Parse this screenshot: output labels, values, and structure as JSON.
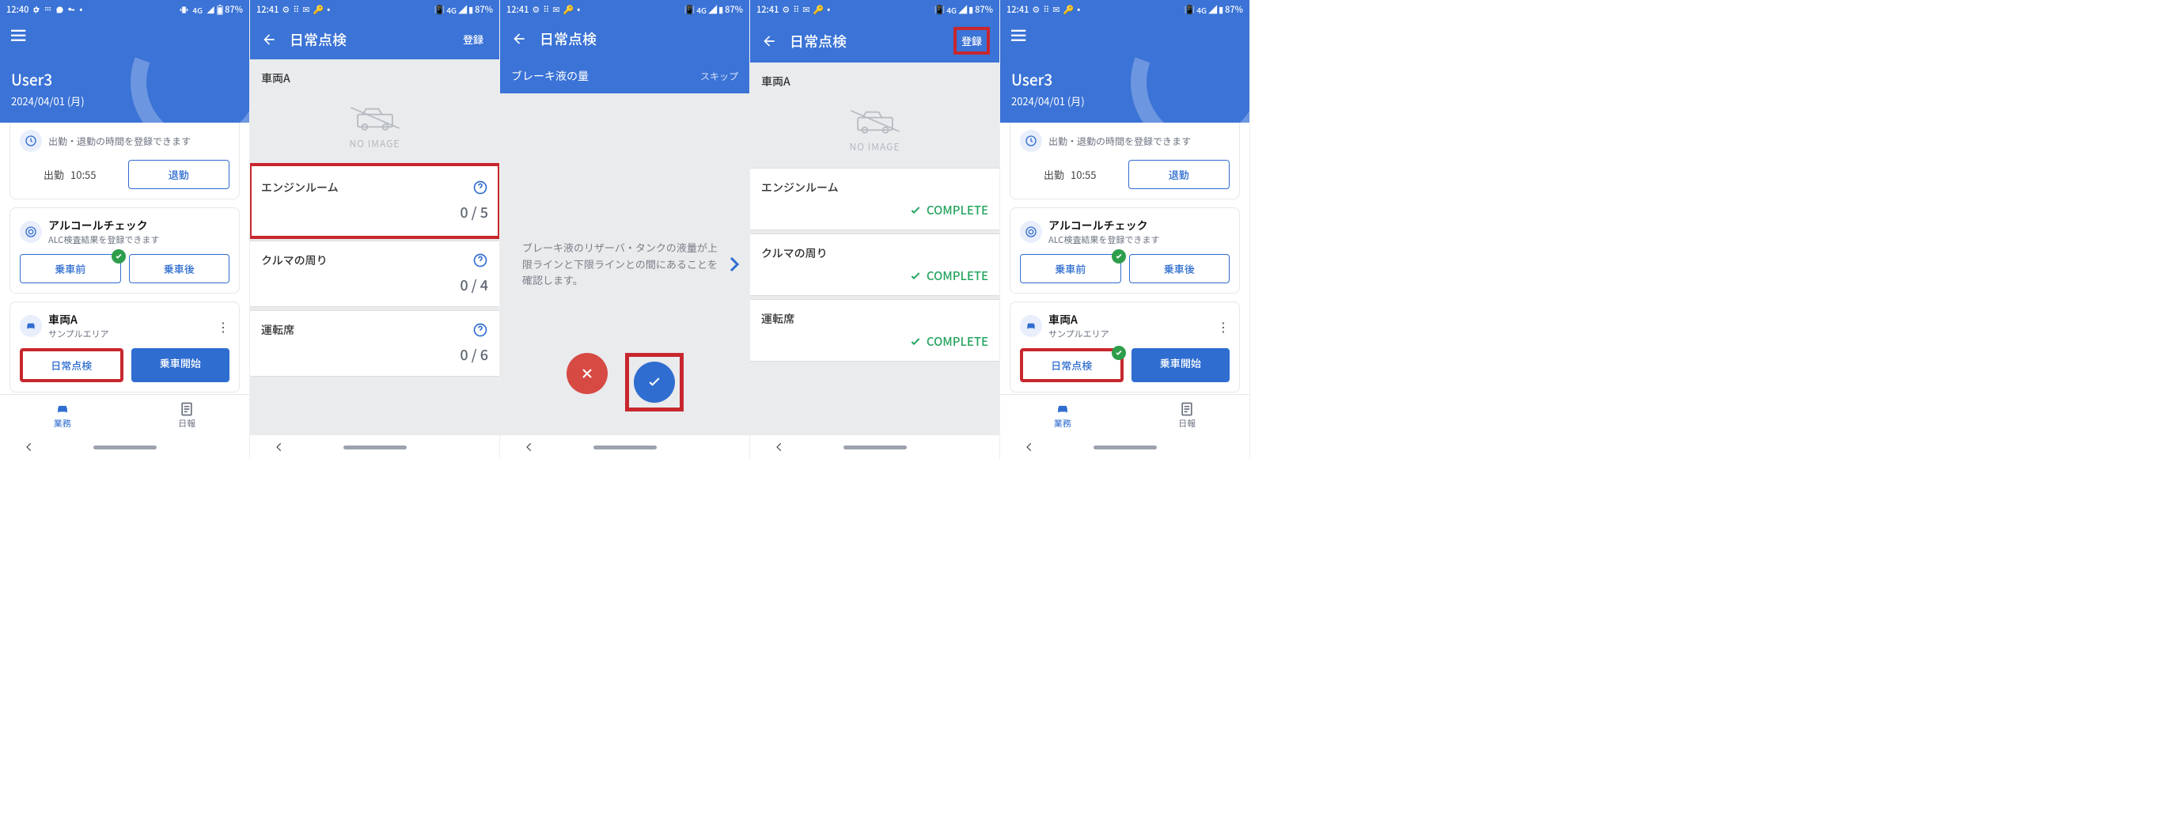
{
  "status": {
    "time_a": "12:40",
    "time_b": "12:41",
    "net": "4G",
    "batt": "87%"
  },
  "home": {
    "user": "User3",
    "date": "2024/04/01 (月)",
    "clock": {
      "sub": "出勤・退勤の時間を登録できます",
      "label_in": "出勤",
      "time_in": "10:55",
      "btn_out": "退勤"
    },
    "alc": {
      "title": "アルコールチェック",
      "sub": "ALC検査結果を登録できます",
      "btn_pre": "乗車前",
      "btn_post": "乗車後"
    },
    "veh": {
      "title": "車両A",
      "area": "サンプルエリア",
      "btn_check": "日常点検",
      "btn_start": "乗車開始"
    },
    "tabs": {
      "a": "業務",
      "b": "日報"
    }
  },
  "insp": {
    "title": "日常点検",
    "register": "登録",
    "veh": "車両A",
    "noimage": "NO IMAGE",
    "items": [
      {
        "title": "エンジンルーム",
        "count": "0 / 5"
      },
      {
        "title": "クルマの周り",
        "count": "0 / 4"
      },
      {
        "title": "運転席",
        "count": "0 / 6"
      }
    ],
    "items_done": [
      {
        "title": "エンジンルーム",
        "status": "COMPLETE"
      },
      {
        "title": "クルマの周り",
        "status": "COMPLETE"
      },
      {
        "title": "運転席",
        "status": "COMPLETE"
      }
    ]
  },
  "step": {
    "title": "日常点検",
    "subtitle": "ブレーキ液の量",
    "skip": "スキップ",
    "body": "ブレーキ液のリザーバ・タンクの液量が上限ラインと下限ラインとの間にあることを確認します。"
  }
}
